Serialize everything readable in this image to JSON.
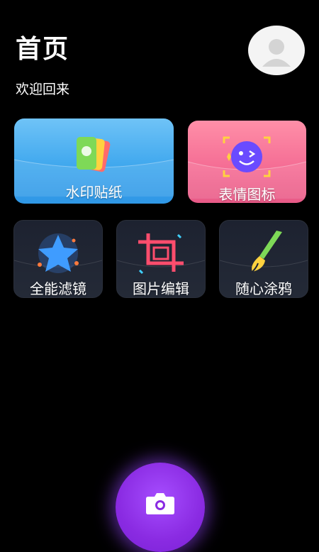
{
  "header": {
    "title": "首页",
    "subtitle": "欢迎回来"
  },
  "cards": {
    "watermark": {
      "label": "水印贴纸",
      "icon": "sticker-cards-icon"
    },
    "emoji": {
      "label": "表情图标",
      "icon": "wink-face-icon"
    },
    "filter": {
      "label": "全能滤镜",
      "icon": "star-icon"
    },
    "edit": {
      "label": "图片编辑",
      "icon": "crop-icon"
    },
    "doodle": {
      "label": "随心涂鸦",
      "icon": "paintbrush-icon"
    }
  },
  "camera": {
    "icon": "camera-icon",
    "accent": "#8a2be2"
  },
  "colors": {
    "background": "#000000",
    "watermark_card": "#40a8ee",
    "emoji_card": "#f46b93",
    "small_card": "#1f2432"
  }
}
